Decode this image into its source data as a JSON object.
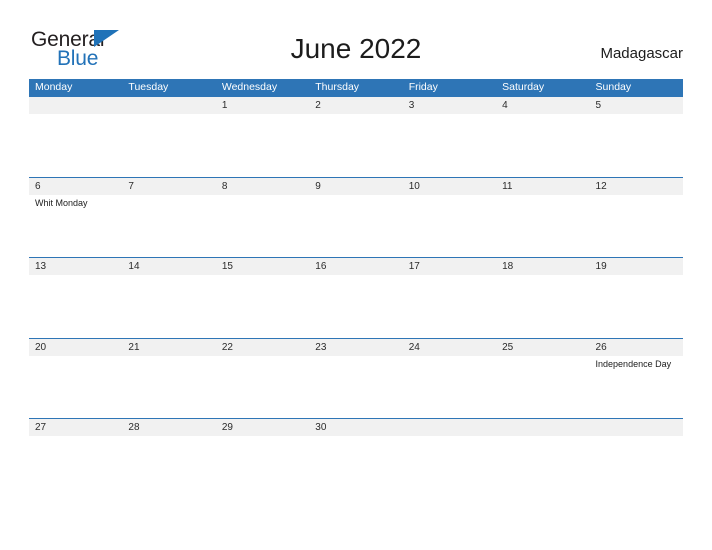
{
  "brand": {
    "name_part1": "General",
    "name_part2": "Blue",
    "color_dark": "#231f20",
    "color_blue": "#2272b8"
  },
  "header": {
    "title": "June 2022",
    "country": "Madagascar",
    "header_bg": "#2e75b6",
    "date_band_bg": "#f1f1f1"
  },
  "weekdays": [
    "Monday",
    "Tuesday",
    "Wednesday",
    "Thursday",
    "Friday",
    "Saturday",
    "Sunday"
  ],
  "weeks": [
    {
      "days": [
        {
          "date": "",
          "events": []
        },
        {
          "date": "",
          "events": []
        },
        {
          "date": "1",
          "events": []
        },
        {
          "date": "2",
          "events": []
        },
        {
          "date": "3",
          "events": []
        },
        {
          "date": "4",
          "events": []
        },
        {
          "date": "5",
          "events": []
        }
      ]
    },
    {
      "days": [
        {
          "date": "6",
          "events": [
            "Whit Monday"
          ]
        },
        {
          "date": "7",
          "events": []
        },
        {
          "date": "8",
          "events": []
        },
        {
          "date": "9",
          "events": []
        },
        {
          "date": "10",
          "events": []
        },
        {
          "date": "11",
          "events": []
        },
        {
          "date": "12",
          "events": []
        }
      ]
    },
    {
      "days": [
        {
          "date": "13",
          "events": []
        },
        {
          "date": "14",
          "events": []
        },
        {
          "date": "15",
          "events": []
        },
        {
          "date": "16",
          "events": []
        },
        {
          "date": "17",
          "events": []
        },
        {
          "date": "18",
          "events": []
        },
        {
          "date": "19",
          "events": []
        }
      ]
    },
    {
      "days": [
        {
          "date": "20",
          "events": []
        },
        {
          "date": "21",
          "events": []
        },
        {
          "date": "22",
          "events": []
        },
        {
          "date": "23",
          "events": []
        },
        {
          "date": "24",
          "events": []
        },
        {
          "date": "25",
          "events": []
        },
        {
          "date": "26",
          "events": [
            "Independence Day"
          ]
        }
      ]
    },
    {
      "days": [
        {
          "date": "27",
          "events": []
        },
        {
          "date": "28",
          "events": []
        },
        {
          "date": "29",
          "events": []
        },
        {
          "date": "30",
          "events": []
        },
        {
          "date": "",
          "events": []
        },
        {
          "date": "",
          "events": []
        },
        {
          "date": "",
          "events": []
        }
      ]
    }
  ]
}
